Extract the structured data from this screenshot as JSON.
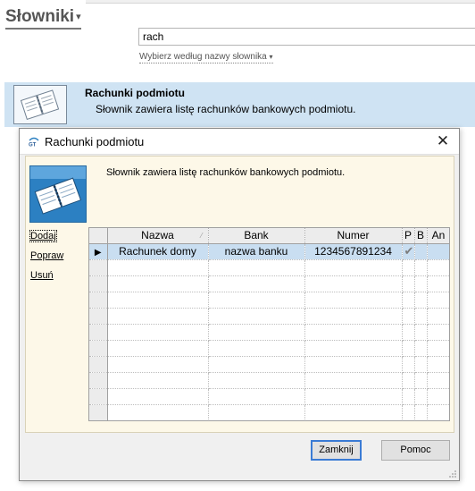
{
  "app": {
    "title": "Słowniki",
    "title_caret": "▾"
  },
  "search": {
    "value": "rach",
    "hint": "Wybierz według nazwy słownika",
    "hint_caret": "▾"
  },
  "dictionary_item": {
    "title": "Rachunki podmiotu",
    "description": "Słownik zawiera listę rachunków bankowych podmiotu.",
    "icon": "book-icon"
  },
  "dialog": {
    "title": "Rachunki podmiotu",
    "logo_text": "GT",
    "close_glyph": "✕",
    "description": "Słownik zawiera listę rachunków bankowych podmiotu.",
    "actions": {
      "add": "Dodaj",
      "edit": "Popraw",
      "delete": "Usuń"
    },
    "table": {
      "columns": [
        "Nazwa",
        "Bank",
        "Numer",
        "P",
        "B",
        "An"
      ],
      "rows": [
        {
          "nazwa": "Rachunek domy",
          "bank": "nazwa banku",
          "numer": "1234567891234",
          "p": "✔",
          "b": "",
          "an": ""
        }
      ],
      "empty_rows": 10,
      "row_indicator": "▶"
    },
    "buttons": {
      "close": "Zamknij",
      "help": "Pomoc"
    }
  },
  "colors": {
    "selection": "#cfe3f3",
    "table_selection": "#c9def1",
    "dialog_body": "#fdf8e8",
    "icon_blue": "#2c80c2"
  }
}
